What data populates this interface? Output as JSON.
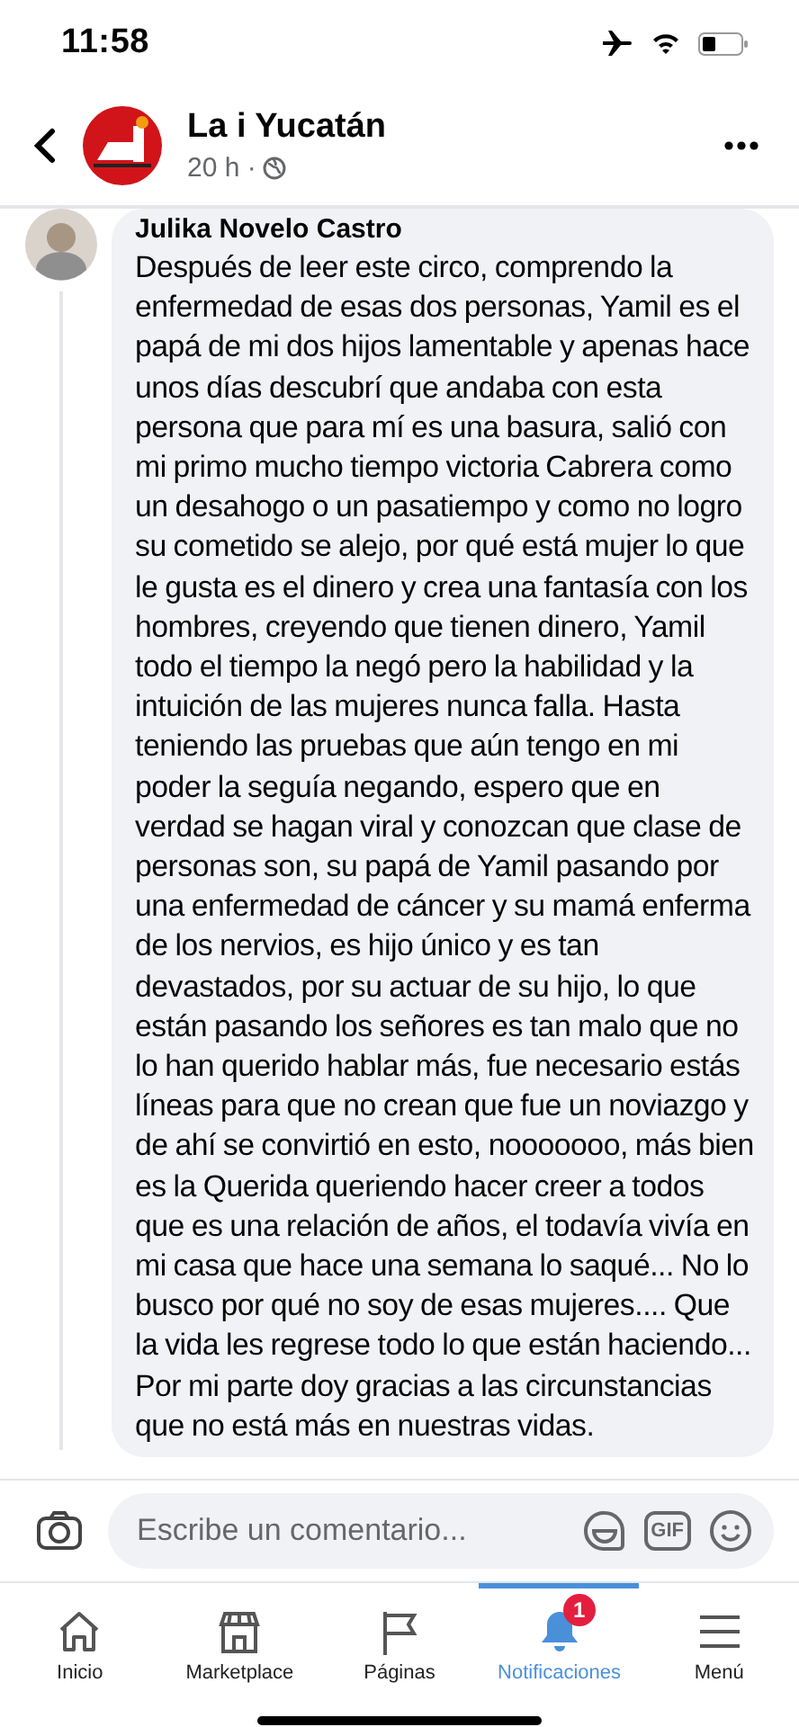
{
  "status_bar": {
    "time": "11:58"
  },
  "header": {
    "page_name": "La i Yucatán",
    "meta": "20 h ·"
  },
  "comment": {
    "author": "Julika Novelo Castro",
    "text": "Después de leer este circo, comprendo la enfermedad de esas dos personas, Yamil es el papá de mi dos hijos lamentable y apenas hace unos días descubrí que andaba con esta persona que para mí es una basura, salió con mi primo mucho tiempo victoria Cabrera como un desahogo o un pasatiempo y como no logro su cometido se alejo, por qué está mujer lo que le gusta es el dinero y crea una fantasía con los hombres, creyendo que tienen dinero, Yamil  todo el tiempo la negó pero la habilidad y la intuición de las mujeres nunca falla. Hasta teniendo las pruebas que aún tengo en mi poder la seguía negando, espero que en verdad se hagan viral y conozcan que clase de personas son, su papá de Yamil pasando por una enfermedad de cáncer y su mamá enferma de los nervios, es hijo único y es tan devastados, por su actuar de su hijo, lo que están pasando los señores es tan malo que no lo han querido hablar más, fue necesario estás líneas para que no crean que fue un noviazgo y de ahí se convirtió en esto, nooooooo,  más bien es la Querida queriendo hacer creer a todos que es una relación de años, el todavía vivía en mi casa que hace una semana lo saqué... No lo busco por qué no soy de esas mujeres.... Que la vida les regrese todo lo que están haciendo... Por mi parte doy gracias a las circunstancias que no está más en nuestras vidas."
  },
  "composer": {
    "placeholder": "Escribe un comentario...",
    "gif_label": "GIF"
  },
  "nav": [
    {
      "kind": "home",
      "label": "Inicio",
      "selected": false
    },
    {
      "kind": "store",
      "label": "Marketplace",
      "selected": false
    },
    {
      "kind": "flag",
      "label": "Páginas",
      "selected": false
    },
    {
      "kind": "bell",
      "label": "Notificaciones",
      "selected": true,
      "badge": "1"
    },
    {
      "kind": "menu",
      "label": "Menú",
      "selected": false
    }
  ]
}
